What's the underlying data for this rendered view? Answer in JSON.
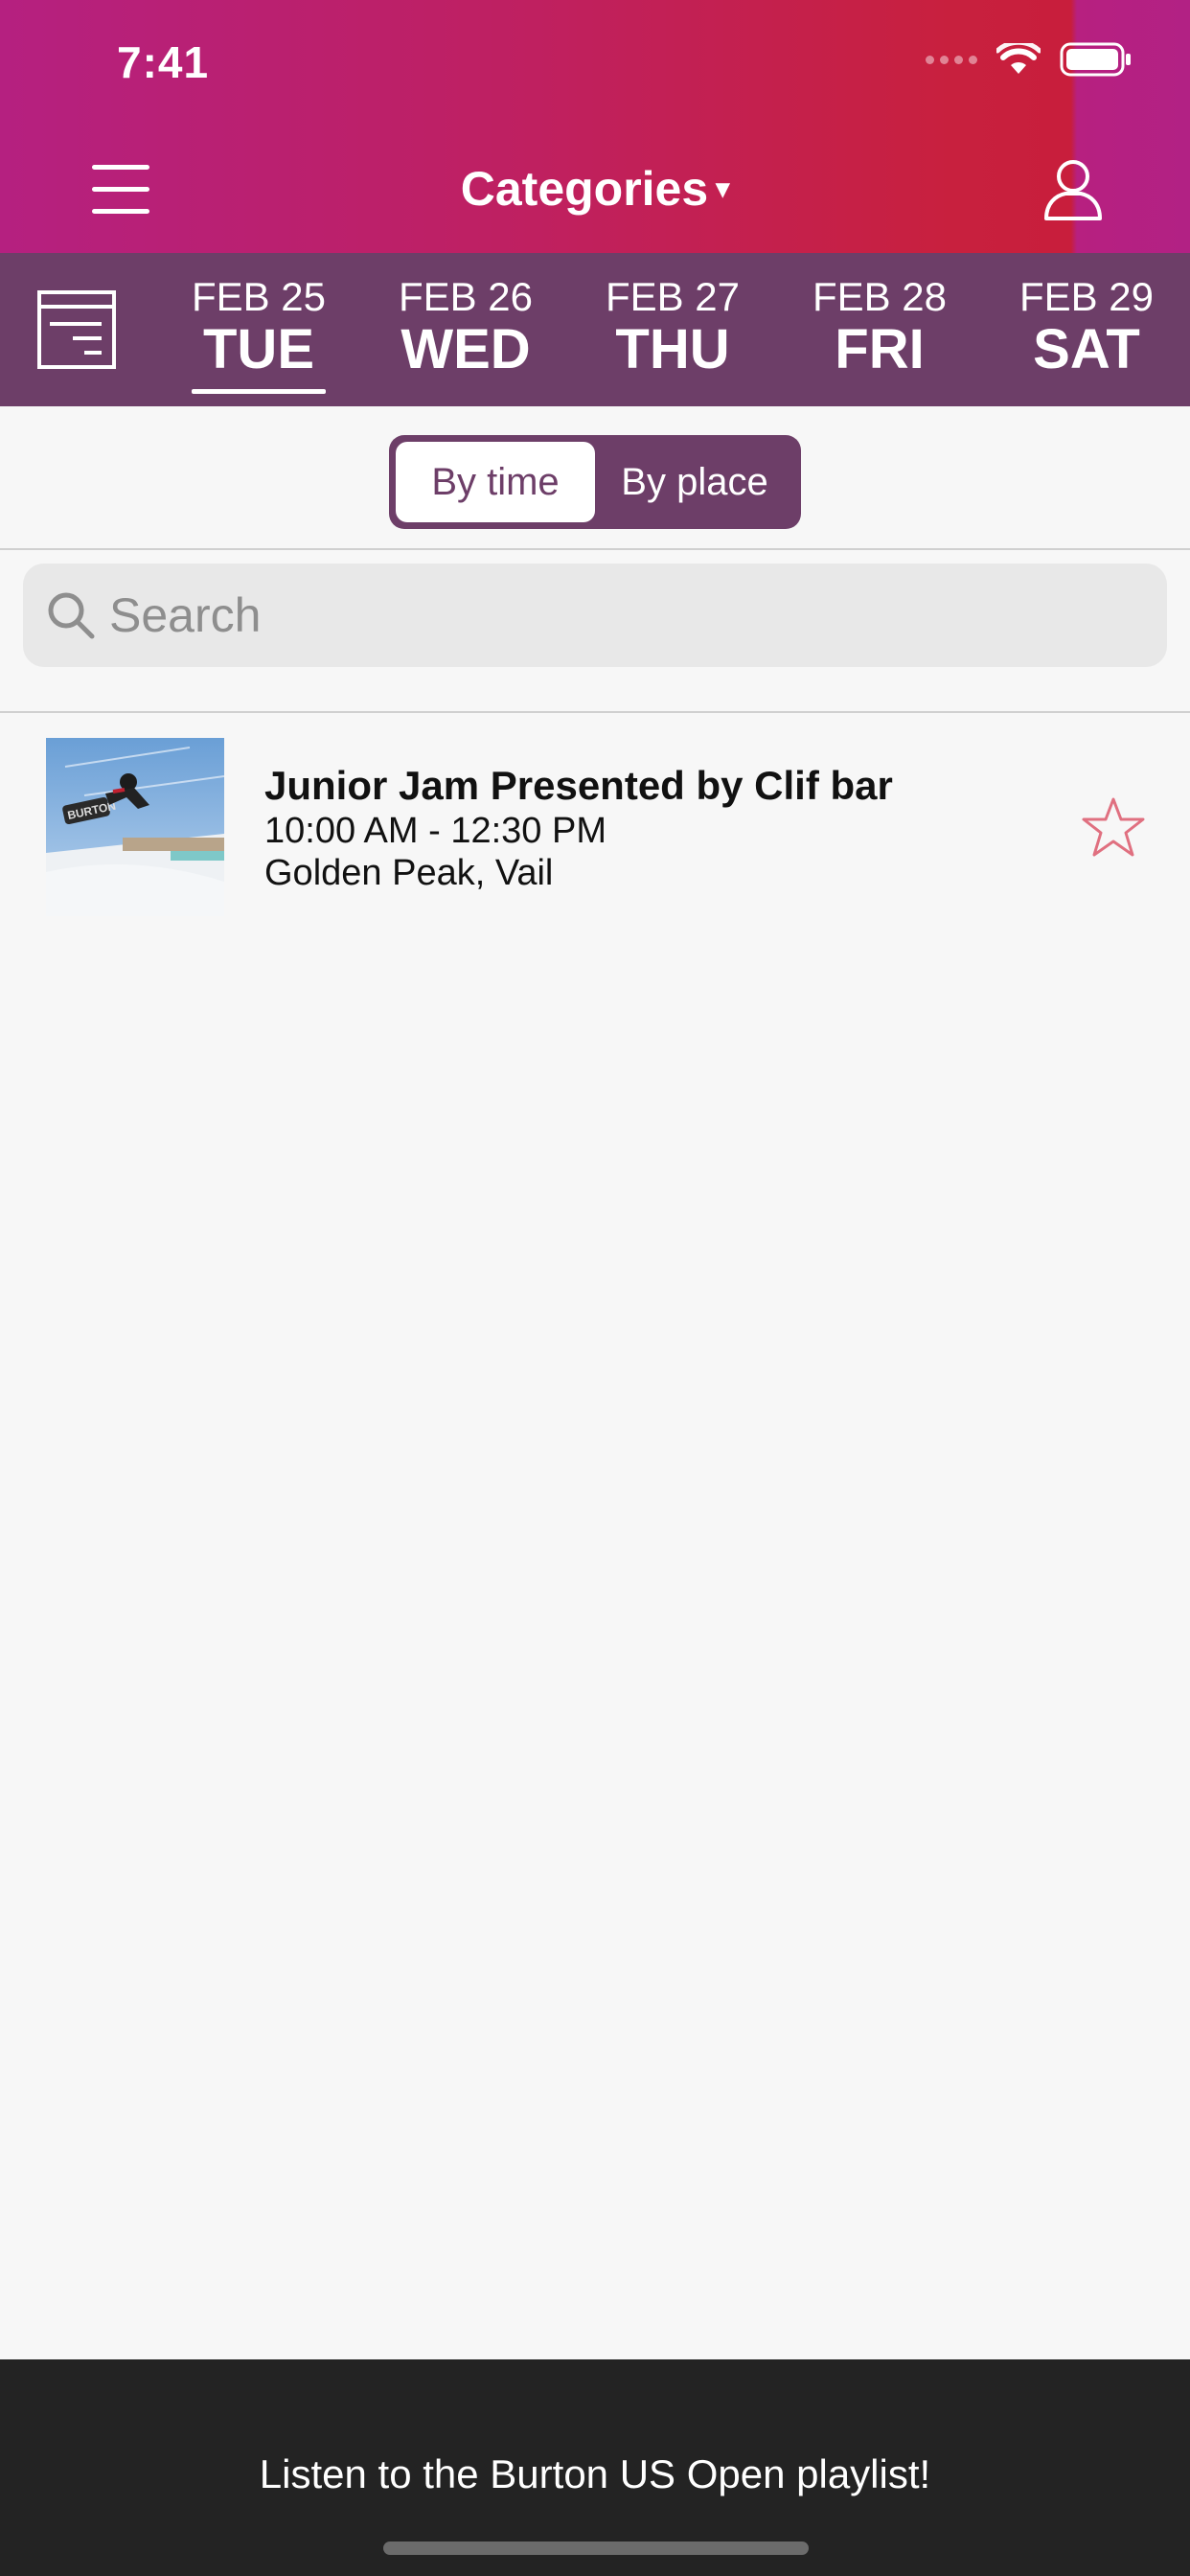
{
  "status_bar": {
    "time": "7:41"
  },
  "header": {
    "title": "Categories",
    "title_caret": "▾",
    "menu_icon": "hamburger-menu-icon",
    "profile_icon": "user-profile-icon"
  },
  "date_strip": {
    "calendar_icon": "schedule-list-icon",
    "dates": [
      {
        "month_day": "FEB 25",
        "weekday": "TUE",
        "selected": true
      },
      {
        "month_day": "FEB 26",
        "weekday": "WED",
        "selected": false
      },
      {
        "month_day": "FEB 27",
        "weekday": "THU",
        "selected": false
      },
      {
        "month_day": "FEB 28",
        "weekday": "FRI",
        "selected": false
      },
      {
        "month_day": "FEB 29",
        "weekday": "SAT",
        "selected": false
      }
    ]
  },
  "segment": {
    "options": [
      "By time",
      "By place"
    ],
    "selected": "By time"
  },
  "search": {
    "placeholder": "Search",
    "value": ""
  },
  "events": [
    {
      "title": "Junior Jam Presented by Clif bar",
      "time": "10:00 AM - 12:30 PM",
      "location": "Golden Peak, Vail",
      "favorited": false
    }
  ],
  "bottom_bar": {
    "text": "Listen to the Burton US Open playlist!"
  },
  "colors": {
    "header_gradient_start": "#b52080",
    "header_gradient_end": "#c81e3c",
    "date_strip": "#6d3e68",
    "star_outline": "#e07080",
    "bottom_bar": "#232323"
  }
}
